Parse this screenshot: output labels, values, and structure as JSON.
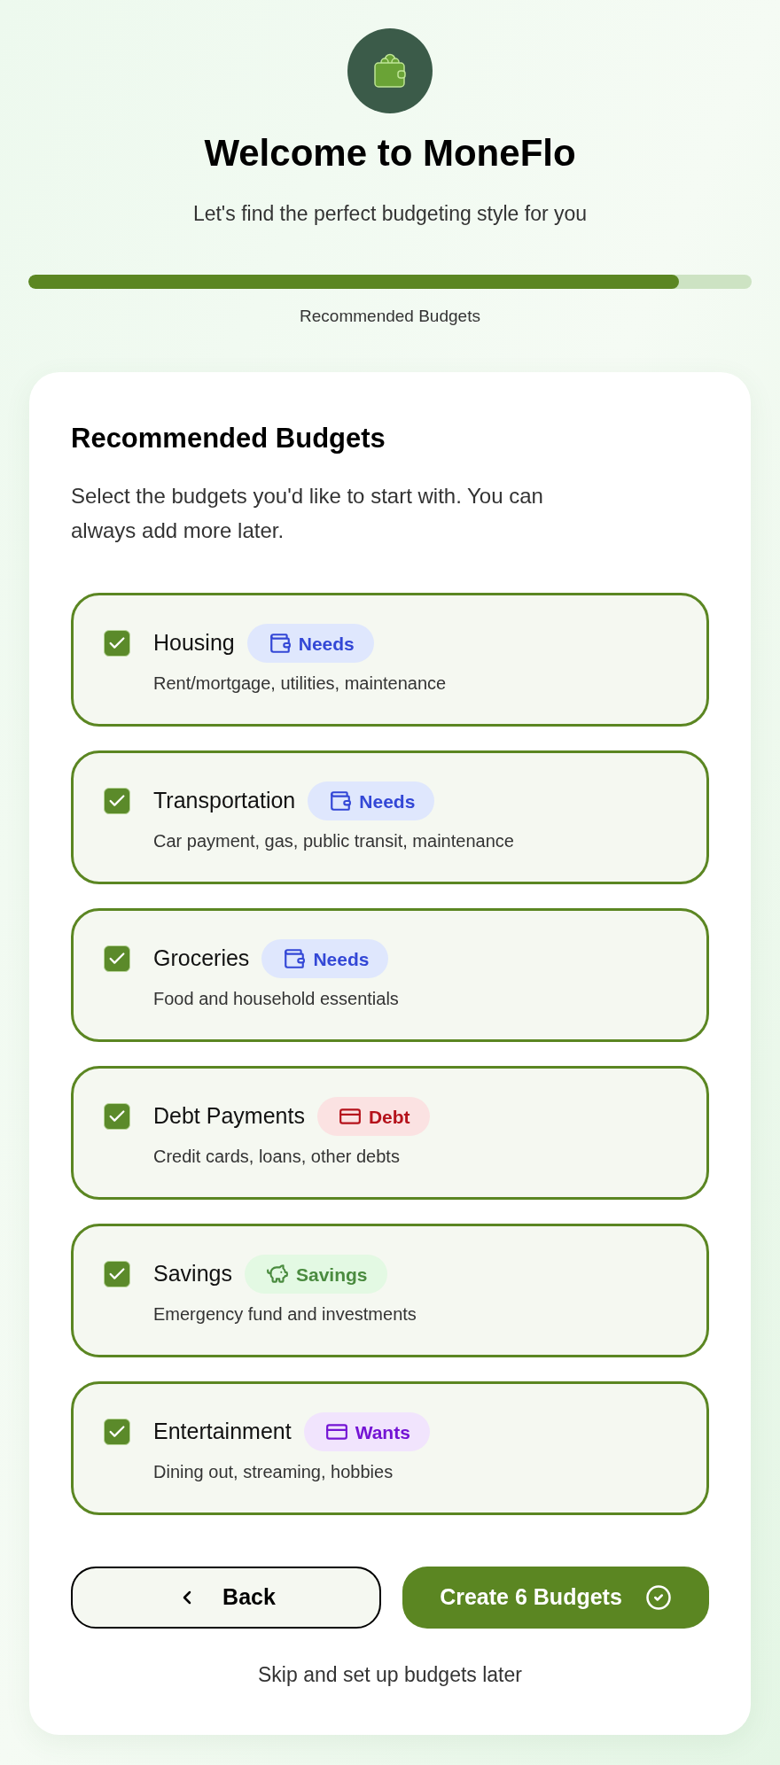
{
  "header": {
    "title": "Welcome to MoneFlo",
    "subtitle": "Let's find the perfect budgeting style for you"
  },
  "progress": {
    "level": 0.9,
    "label": "Recommended Budgets"
  },
  "panel": {
    "title": "Recommended Budgets",
    "description": "Select the budgets you'd like to start with. You can always add more later.",
    "budgets": [
      {
        "name": "Housing",
        "checked": true,
        "category": {
          "kind": "needs",
          "label": "Needs"
        },
        "description": "Rent/mortgage, utilities, maintenance"
      },
      {
        "name": "Transportation",
        "checked": true,
        "category": {
          "kind": "needs",
          "label": "Needs"
        },
        "description": "Car payment, gas, public transit, maintenance"
      },
      {
        "name": "Groceries",
        "checked": true,
        "category": {
          "kind": "needs",
          "label": "Needs"
        },
        "description": "Food and household essentials"
      },
      {
        "name": "Debt Payments",
        "checked": true,
        "category": {
          "kind": "debt",
          "label": "Debt"
        },
        "description": "Credit cards, loans, other debts"
      },
      {
        "name": "Savings",
        "checked": true,
        "category": {
          "kind": "savings",
          "label": "Savings"
        },
        "description": "Emergency fund and investments"
      },
      {
        "name": "Entertainment",
        "checked": true,
        "category": {
          "kind": "wants",
          "label": "Wants"
        },
        "description": "Dining out, streaming, hobbies"
      }
    ]
  },
  "actions": {
    "back": "Back",
    "create": "Create 6 Budgets",
    "skip": "Skip and set up budgets later"
  }
}
